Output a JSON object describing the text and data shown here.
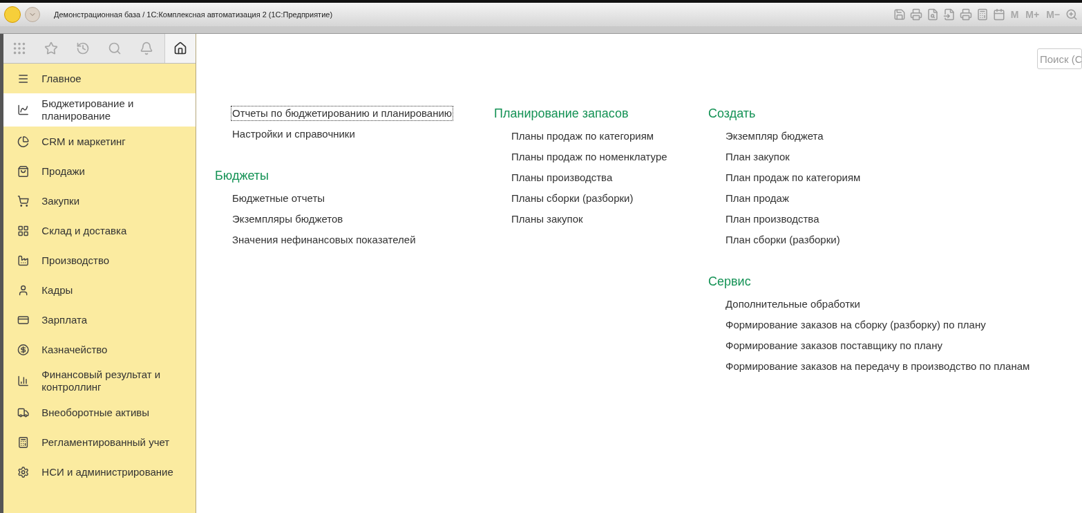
{
  "window": {
    "title": "Демонстрационная база / 1С:Комплексная автоматизация 2  (1С:Предприятие)"
  },
  "toolbar_right": [
    "M",
    "M+",
    "M−"
  ],
  "search": {
    "placeholder": "Поиск (С"
  },
  "sidebar": {
    "items": [
      {
        "label": "Главное",
        "selected": false
      },
      {
        "label": "Бюджетирование и планирование",
        "selected": true
      },
      {
        "label": "CRM и маркетинг",
        "selected": false
      },
      {
        "label": "Продажи",
        "selected": false
      },
      {
        "label": "Закупки",
        "selected": false
      },
      {
        "label": "Склад и доставка",
        "selected": false
      },
      {
        "label": "Производство",
        "selected": false
      },
      {
        "label": "Кадры",
        "selected": false
      },
      {
        "label": "Зарплата",
        "selected": false
      },
      {
        "label": "Казначейство",
        "selected": false
      },
      {
        "label": "Финансовый результат и контроллинг",
        "selected": false
      },
      {
        "label": "Внеоборотные активы",
        "selected": false
      },
      {
        "label": "Регламентированный учет",
        "selected": false
      },
      {
        "label": "НСИ и администрирование",
        "selected": false
      }
    ]
  },
  "columns": [
    [
      {
        "links": [
          {
            "label": "Отчеты по бюджетированию и планированию",
            "focused": true
          },
          {
            "label": "Настройки и справочники",
            "focused": false
          }
        ]
      },
      {
        "heading": "Бюджеты",
        "links": [
          {
            "label": "Бюджетные отчеты",
            "focused": false
          },
          {
            "label": "Экземпляры бюджетов",
            "focused": false
          },
          {
            "label": "Значения нефинансовых показателей",
            "focused": false
          }
        ]
      }
    ],
    [
      {
        "heading": "Планирование запасов",
        "links": [
          {
            "label": "Планы продаж по категориям",
            "focused": false
          },
          {
            "label": "Планы продаж по номенклатуре",
            "focused": false
          },
          {
            "label": "Планы производства",
            "focused": false
          },
          {
            "label": "Планы сборки (разборки)",
            "focused": false
          },
          {
            "label": "Планы закупок",
            "focused": false
          }
        ]
      }
    ],
    [
      {
        "heading": "Создать",
        "links": [
          {
            "label": "Экземпляр бюджета",
            "focused": false
          },
          {
            "label": "План закупок",
            "focused": false
          },
          {
            "label": "План продаж по категориям",
            "focused": false
          },
          {
            "label": "План продаж",
            "focused": false
          },
          {
            "label": "План производства",
            "focused": false
          },
          {
            "label": "План сборки (разборки)",
            "focused": false
          }
        ]
      },
      {
        "heading": "Сервис",
        "links": [
          {
            "label": "Дополнительные обработки",
            "focused": false
          },
          {
            "label": "Формирование заказов на сборку (разборку) по плану",
            "focused": false
          },
          {
            "label": "Формирование заказов поставщику по плану",
            "focused": false
          },
          {
            "label": "Формирование заказов на передачу в производство по планам",
            "focused": false
          }
        ]
      }
    ]
  ]
}
